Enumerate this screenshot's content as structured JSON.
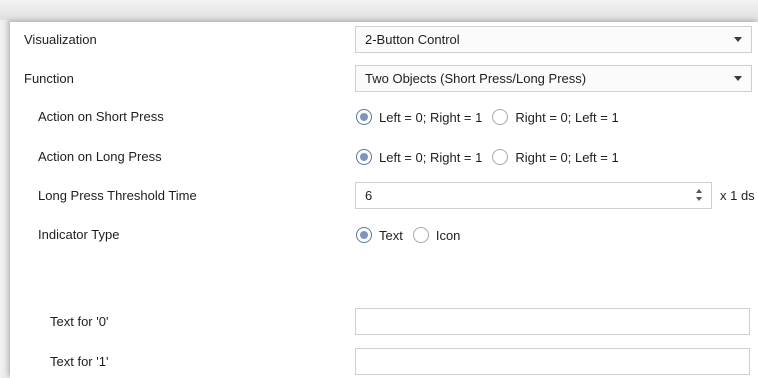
{
  "visualization": {
    "label": "Visualization",
    "value": "2-Button Control"
  },
  "function": {
    "label": "Function",
    "value": "Two Objects (Short Press/Long Press)"
  },
  "short_press": {
    "label": "Action on Short Press",
    "options": [
      "Left = 0; Right = 1",
      "Right = 0; Left = 1"
    ],
    "selected": "Left = 0; Right = 1"
  },
  "long_press": {
    "label": "Action on Long Press",
    "options": [
      "Left = 0; Right = 1",
      "Right = 0; Left = 1"
    ],
    "selected": "Left = 0; Right = 1"
  },
  "threshold": {
    "label": "Long Press Threshold Time",
    "value": "6",
    "unit": "x 1 ds"
  },
  "indicator_type": {
    "label": "Indicator Type",
    "options": [
      "Text",
      "Icon"
    ],
    "selected": "Text"
  },
  "text_0": {
    "label": "Text for '0'",
    "value": ""
  },
  "text_1": {
    "label": "Text for '1'",
    "value": ""
  },
  "colors": {
    "radio_selected": "#7d95bd",
    "field_border": "#cfcfcf"
  }
}
